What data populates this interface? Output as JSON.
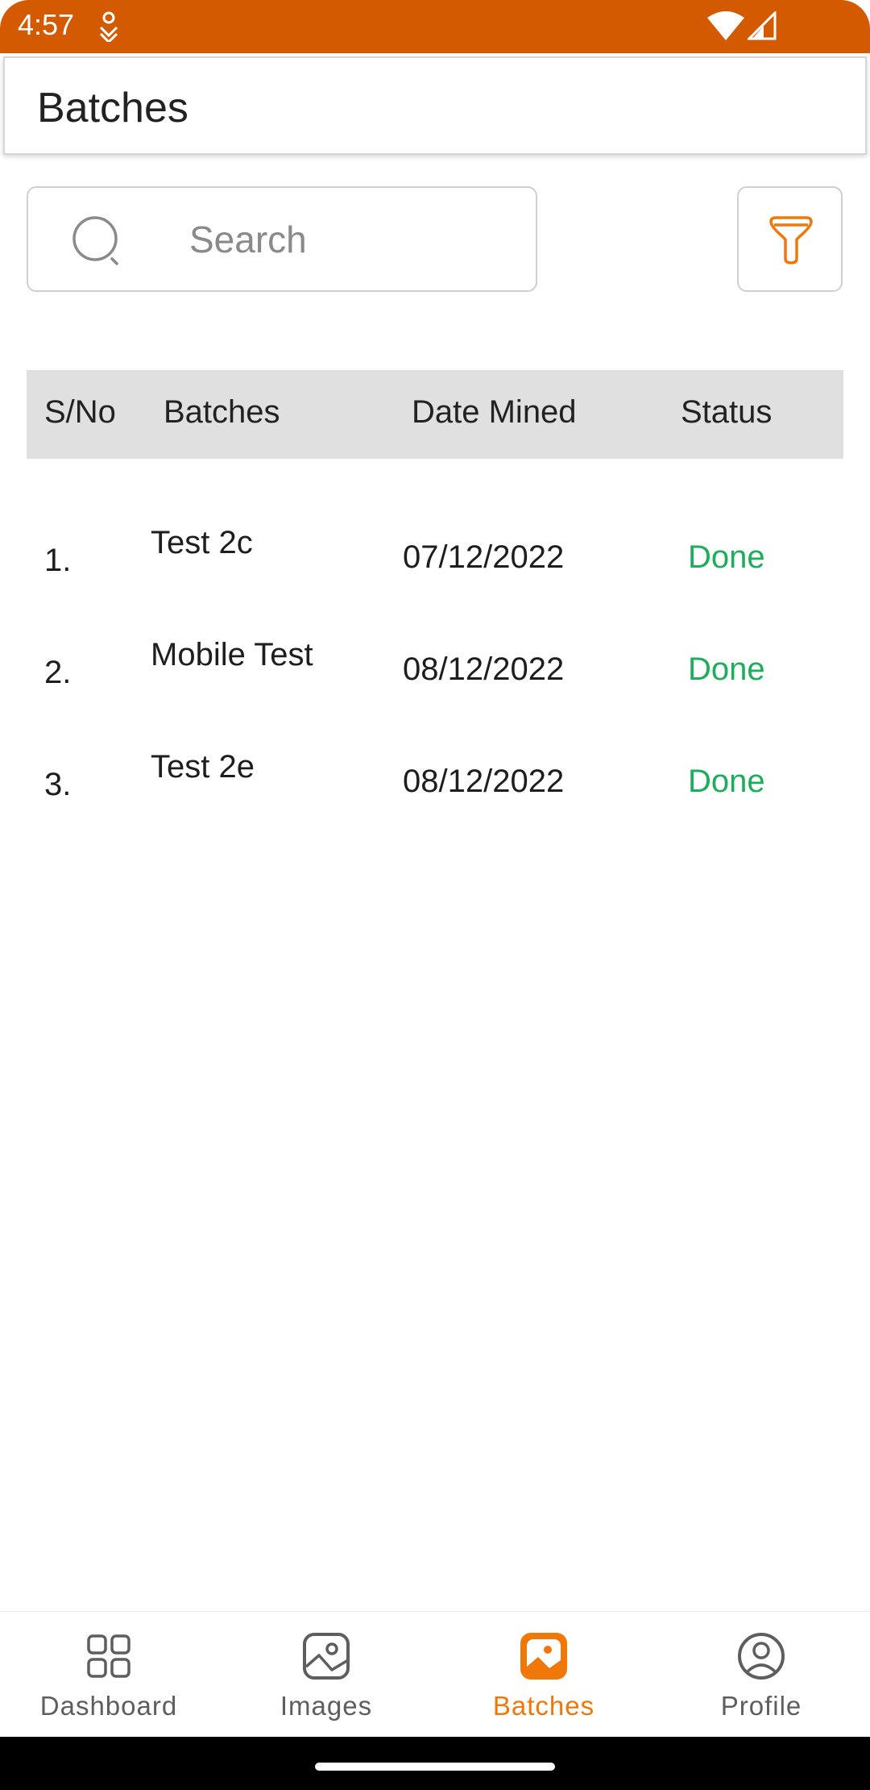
{
  "status_bar": {
    "time": "4:57"
  },
  "app_bar": {
    "title": "Batches"
  },
  "search": {
    "placeholder": "Search",
    "value": ""
  },
  "table": {
    "headers": [
      "S/No",
      "Batches",
      "Date Mined",
      "Status"
    ],
    "rows": [
      {
        "sno": "1.",
        "batch": "Test 2c",
        "date": "07/12/2022",
        "status": "Done"
      },
      {
        "sno": "2.",
        "batch": "Mobile Test",
        "date": "08/12/2022",
        "status": "Done"
      },
      {
        "sno": "3.",
        "batch": "Test 2e",
        "date": "08/12/2022",
        "status": "Done"
      }
    ]
  },
  "bottom_nav": {
    "items": [
      {
        "label": "Dashboard",
        "icon": "grid-icon",
        "active": false
      },
      {
        "label": "Images",
        "icon": "image-icon",
        "active": false
      },
      {
        "label": "Batches",
        "icon": "image-icon",
        "active": true
      },
      {
        "label": "Profile",
        "icon": "user-circle-icon",
        "active": false
      }
    ]
  },
  "colors": {
    "status_bar": "#D35A00",
    "accent": "#F0780A",
    "status_done": "#1BAE5B",
    "table_header_bg": "#E0E0E0",
    "nav_inactive": "#5E5E5E"
  }
}
